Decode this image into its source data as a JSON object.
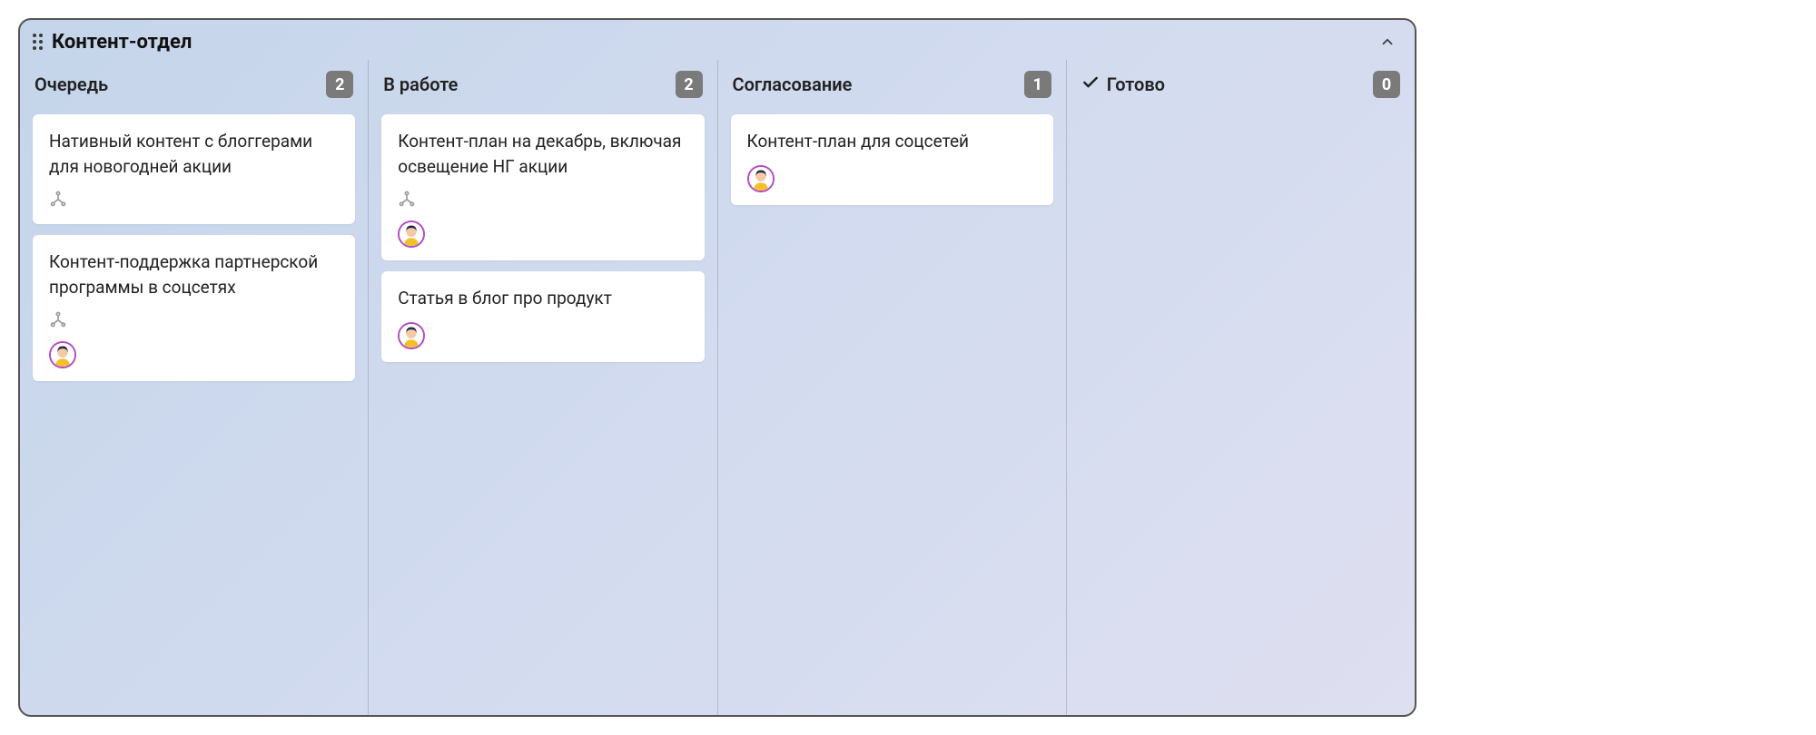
{
  "board": {
    "title": "Контент-отдел",
    "columns": [
      {
        "title": "Очередь",
        "count": "2",
        "done": false,
        "cards": [
          {
            "title": "Нативный контент с блоггерами для новогодней акции",
            "hasSubtasks": true,
            "hasAvatar": false
          },
          {
            "title": "Контент-поддержка партнерской программы в соцсетях",
            "hasSubtasks": true,
            "hasAvatar": true
          }
        ]
      },
      {
        "title": "В работе",
        "count": "2",
        "done": false,
        "cards": [
          {
            "title": "Контент-план на декабрь, включая освещение НГ акции",
            "hasSubtasks": true,
            "hasAvatar": true
          },
          {
            "title": "Статья в блог про продукт",
            "hasSubtasks": false,
            "hasAvatar": true
          }
        ]
      },
      {
        "title": "Согласование",
        "count": "1",
        "done": false,
        "cards": [
          {
            "title": "Контент-план для соцсетей",
            "hasSubtasks": false,
            "hasAvatar": true
          }
        ]
      },
      {
        "title": "Готово",
        "count": "0",
        "done": true,
        "cards": []
      }
    ]
  }
}
